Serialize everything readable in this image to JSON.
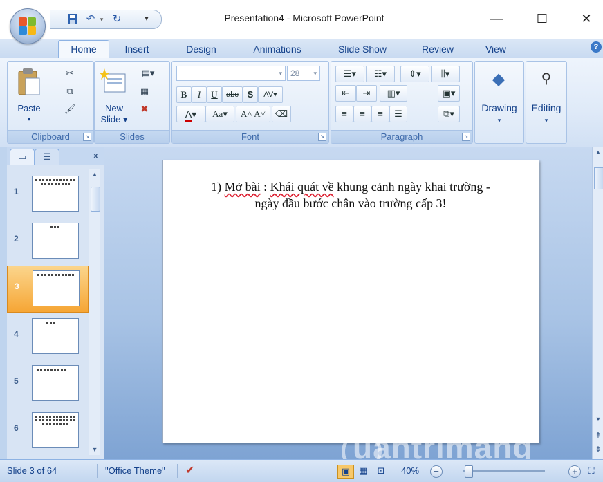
{
  "window": {
    "title": "Presentation4 - Microsoft PowerPoint",
    "minimize": "—",
    "maximize": "☐",
    "close": "✕"
  },
  "qat": {
    "save_icon": "save-icon",
    "undo_icon": "undo-icon",
    "redo_icon": "redo-icon",
    "more_icon": "customize-icon"
  },
  "tabs": [
    {
      "label": "Home"
    },
    {
      "label": "Insert"
    },
    {
      "label": "Design"
    },
    {
      "label": "Animations"
    },
    {
      "label": "Slide Show"
    },
    {
      "label": "Review"
    },
    {
      "label": "View"
    }
  ],
  "ribbon": {
    "clipboard": {
      "label": "Clipboard",
      "paste": "Paste"
    },
    "slides": {
      "label": "Slides",
      "new_slide_1": "New",
      "new_slide_2": "Slide ▾"
    },
    "font": {
      "label": "Font",
      "size": "28"
    },
    "paragraph": {
      "label": "Paragraph"
    },
    "drawing": {
      "label": "Drawing"
    },
    "editing": {
      "label": "Editing"
    }
  },
  "panel": {
    "close": "x"
  },
  "thumbnails": [
    {
      "num": "1"
    },
    {
      "num": "2"
    },
    {
      "num": "3"
    },
    {
      "num": "4"
    },
    {
      "num": "5"
    },
    {
      "num": "6"
    }
  ],
  "slide": {
    "line1_a": "1) ",
    "line1_b": "Mở bài",
    "line1_c": " : ",
    "line1_d": "Khái quát về",
    "line1_e": " khung cảnh ngày khai trường -",
    "line2": "ngày đầu bước chân vào trường cấp 3!"
  },
  "status": {
    "slide_info": "Slide 3 of 64",
    "theme": "\"Office Theme\"",
    "zoom": "40%"
  },
  "watermark": "uantrimang"
}
